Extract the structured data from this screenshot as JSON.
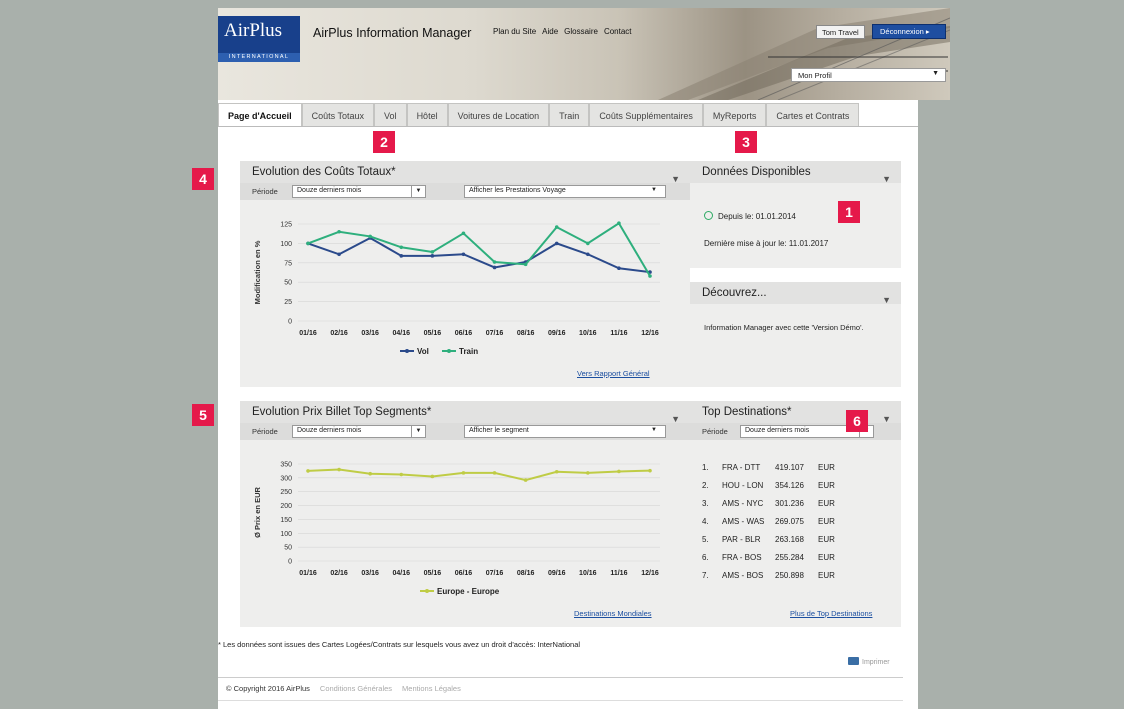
{
  "header": {
    "logo_text": "AirPlus",
    "logo_subtext": "INTERNATIONAL",
    "app_title": "AirPlus Information Manager",
    "nav": [
      "Plan du Site",
      "Aide",
      "Glossaire",
      "Contact"
    ],
    "user_name": "Tom Travel",
    "logout_label": "Déconnexion ▸",
    "profile_select": "Mon Profil"
  },
  "tabs": [
    "Page d'Accueil",
    "Coûts Totaux",
    "Vol",
    "Hôtel",
    "Voitures de Location",
    "Train",
    "Coûts Supplémentaires",
    "MyReports",
    "Cartes et Contrats"
  ],
  "badges": [
    "1",
    "2",
    "3",
    "4",
    "5",
    "6"
  ],
  "panel_costs": {
    "title": "Evolution des Coûts Totaux*",
    "period_label": "Période",
    "period_value": "Douze derniers mois",
    "service_value": "Afficher les Prestations Voyage",
    "link": "Vers Rapport Général"
  },
  "panel_ticket": {
    "title": "Evolution Prix Billet Top Segments*",
    "period_label": "Période",
    "period_value": "Douze derniers mois",
    "segment_value": "Afficher le segment",
    "link": "Destinations Mondiales"
  },
  "panel_data": {
    "title": "Données Disponibles",
    "since": "Depuis le: 01.01.2014",
    "last_update": "Dernière mise à jour le: 11.01.2017"
  },
  "panel_discover": {
    "title": "Découvrez...",
    "text": "Information Manager avec cette 'Version Démo'."
  },
  "panel_top": {
    "title": "Top Destinations*",
    "period_label": "Période",
    "period_value": "Douze derniers mois",
    "rows": [
      {
        "rank": "1.",
        "route": "FRA - DTT",
        "amount": "419.107",
        "currency": "EUR"
      },
      {
        "rank": "2.",
        "route": "HOU - LON",
        "amount": "354.126",
        "currency": "EUR"
      },
      {
        "rank": "3.",
        "route": "AMS - NYC",
        "amount": "301.236",
        "currency": "EUR"
      },
      {
        "rank": "4.",
        "route": "AMS - WAS",
        "amount": "269.075",
        "currency": "EUR"
      },
      {
        "rank": "5.",
        "route": "PAR - BLR",
        "amount": "263.168",
        "currency": "EUR"
      },
      {
        "rank": "6.",
        "route": "FRA - BOS",
        "amount": "255.284",
        "currency": "EUR"
      },
      {
        "rank": "7.",
        "route": "AMS - BOS",
        "amount": "250.898",
        "currency": "EUR"
      }
    ],
    "link": "Plus de Top Destinations"
  },
  "footnote": "* Les données sont issues des Cartes Logées/Contrats sur lesquels vous avez un droit d'accès: InterNational",
  "print_label": "Imprimer",
  "footer": {
    "copyright": "© Copyright 2016 AirPlus",
    "terms": "Conditions Générales",
    "legal": "Mentions Légales"
  },
  "colors": {
    "vol": "#2b4a8b",
    "train": "#2eaf7d",
    "europe": "#bfcc45",
    "badge": "#e5194a"
  },
  "chart_data": [
    {
      "type": "line",
      "categories": [
        "01/16",
        "02/16",
        "03/16",
        "04/16",
        "05/16",
        "06/16",
        "07/16",
        "08/16",
        "09/16",
        "10/16",
        "11/16",
        "12/16"
      ],
      "ylabel": "Modification en %",
      "ylim": [
        0,
        125
      ],
      "yticks": [
        "0",
        "25",
        "50",
        "75",
        "100",
        "125"
      ],
      "grid": true,
      "legend": "bottom",
      "series": [
        {
          "name": "Vol",
          "values": [
            100,
            86,
            107,
            84,
            84,
            86,
            69,
            76,
            100,
            86,
            68,
            63
          ]
        },
        {
          "name": "Train",
          "values": [
            100,
            115,
            109,
            95,
            89,
            113,
            76,
            73,
            121,
            100,
            126,
            58
          ]
        }
      ]
    },
    {
      "type": "line",
      "categories": [
        "01/16",
        "02/16",
        "03/16",
        "04/16",
        "05/16",
        "06/16",
        "07/16",
        "08/16",
        "09/16",
        "10/16",
        "11/16",
        "12/16"
      ],
      "ylabel": "Ø Prix en EUR",
      "ylim": [
        0,
        350
      ],
      "yticks": [
        "0",
        "50",
        "100",
        "150",
        "200",
        "250",
        "300",
        "350"
      ],
      "grid": true,
      "legend": "bottom",
      "series": [
        {
          "name": "Europe - Europe",
          "values": [
            325,
            330,
            315,
            312,
            305,
            318,
            318,
            292,
            322,
            318,
            323,
            326
          ]
        }
      ]
    }
  ]
}
